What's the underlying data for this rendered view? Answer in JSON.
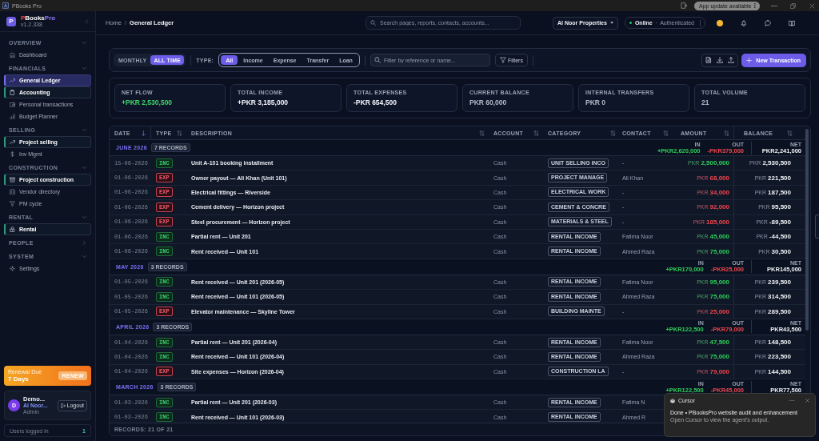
{
  "titlebar": {
    "app_name": "PBooks Pro",
    "update_notice": "App update available"
  },
  "sidebar": {
    "logo_letter": "P",
    "brand": [
      {
        "text": "P",
        "color": "#ef4444"
      },
      {
        "text": "Books",
        "color": "#ffffff"
      },
      {
        "text": "Pro",
        "color": "#8b7cf6"
      }
    ],
    "version": "v1.2.338",
    "sections": [
      {
        "title": "OVERVIEW",
        "expanded": true,
        "items": [
          {
            "label": "Dashboard",
            "selected": false,
            "highlighted": false
          }
        ]
      },
      {
        "title": "FINANCIALS",
        "expanded": true,
        "items": [
          {
            "label": "General Ledger",
            "selected": true,
            "highlighted": false
          },
          {
            "label": "Accounting",
            "selected": false,
            "highlighted": true
          },
          {
            "label": "Personal transactions",
            "selected": false,
            "highlighted": false
          },
          {
            "label": "Budget Planner",
            "selected": false,
            "highlighted": false
          }
        ]
      },
      {
        "title": "SELLING",
        "expanded": true,
        "items": [
          {
            "label": "Project selling",
            "selected": false,
            "highlighted": true
          },
          {
            "label": "Inv Mgmt",
            "selected": false,
            "highlighted": false
          }
        ]
      },
      {
        "title": "CONSTRUCTION",
        "expanded": true,
        "items": [
          {
            "label": "Project construction",
            "selected": false,
            "highlighted": true
          },
          {
            "label": "Vendor directory",
            "selected": false,
            "highlighted": false
          },
          {
            "label": "PM cycle",
            "selected": false,
            "highlighted": false
          }
        ]
      },
      {
        "title": "RENTAL",
        "expanded": true,
        "items": [
          {
            "label": "Rental",
            "selected": false,
            "highlighted": true
          }
        ]
      },
      {
        "title": "PEOPLE",
        "expanded": false
      },
      {
        "title": "SYSTEM",
        "expanded": true,
        "items": [
          {
            "label": "Settings",
            "selected": false,
            "highlighted": false
          }
        ]
      }
    ],
    "renewal": {
      "title": "Renewal Due",
      "days": "7 Days",
      "button": "RENEW"
    },
    "user": {
      "avatar_letter": "D",
      "name": "Demo...",
      "organization": "Al Noor...",
      "role": "Admin",
      "logout": "Logout"
    },
    "sessions": {
      "label": "Users logged in",
      "count": "1"
    }
  },
  "topbar": {
    "breadcrumbs": [
      "Home",
      "General Ledger"
    ],
    "breadcrumb_separator": "/",
    "search_placeholder": "Search pages, reports, contacts, accounts...",
    "company": "Al Noor Properties",
    "status": {
      "online": true,
      "label": "Online",
      "detail": "Authenticated"
    }
  },
  "toolbar": {
    "periods": [
      {
        "label": "MONTHLY",
        "selected": false
      },
      {
        "label": "ALL TIME",
        "selected": true
      }
    ],
    "type_label": "TYPE:",
    "types": [
      {
        "label": "All",
        "selected": true
      },
      {
        "label": "Income",
        "selected": false
      },
      {
        "label": "Expense",
        "selected": false
      },
      {
        "label": "Transfer",
        "selected": false
      },
      {
        "label": "Loan",
        "selected": false
      }
    ],
    "filter_placeholder": "Filter by reference or name...",
    "filters_button": "Filters",
    "new_button": "New Transaction"
  },
  "stats": [
    {
      "label": "NET FLOW",
      "value": "+PKR 2,530,500",
      "color": "#3fd46b"
    },
    {
      "label": "TOTAL INCOME",
      "value": "+PKR 3,185,000",
      "color": "#f1f3f8"
    },
    {
      "label": "TOTAL EXPENSES",
      "value": "-PKR 654,500",
      "color": "#f1f3f8"
    },
    {
      "label": "CURRENT BALANCE",
      "value": "PKR 60,000",
      "color": "#b3bac8"
    },
    {
      "label": "INTERNAL TRANSFERS",
      "value": "PKR 0",
      "color": "#b3bac8"
    },
    {
      "label": "TOTAL VOLUME",
      "value": "21",
      "color": "#b3bac8"
    }
  ],
  "table": {
    "columns": [
      {
        "label": "DATE",
        "sorted": true
      },
      {
        "label": "TYPE",
        "sorted": false
      },
      {
        "label": "DESCRIPTION",
        "sorted": false
      },
      {
        "label": "ACCOUNT",
        "sorted": false
      },
      {
        "label": "CATEGORY",
        "sorted": false
      },
      {
        "label": "CONTACT",
        "sorted": false
      },
      {
        "label": "AMOUNT",
        "sorted": false
      },
      {
        "label": "BALANCE",
        "sorted": false
      }
    ],
    "groups": [
      {
        "month": "JUNE 2026",
        "count": "7 RECORDS",
        "in_label": "IN",
        "in": "+PKR2,620,000",
        "out_label": "OUT",
        "out": "-PKR379,000",
        "net_label": "NET",
        "net": "PKR2,241,000",
        "rows": [
          {
            "date": "15-06-2026",
            "type": "INC",
            "kind": "income",
            "description": "Unit A-101 booking installment",
            "account": "Cash",
            "category": "UNIT SELLING INCO",
            "contact": "-",
            "amount_currency": "PKR",
            "amount": "2,500,000",
            "balance_currency": "PKR",
            "balance": "2,530,500"
          },
          {
            "date": "01-06-2026",
            "type": "EXP",
            "kind": "expense",
            "description": "Owner payout — Ali Khan (Unit 101)",
            "account": "Cash",
            "category": "PROJECT MANAGE",
            "contact": "Ali Khan",
            "amount_currency": "PKR",
            "amount": "68,000",
            "balance_currency": "PKR",
            "balance": "221,500"
          },
          {
            "date": "01-06-2026",
            "type": "EXP",
            "kind": "expense",
            "description": "Electrical fittings — Riverside",
            "account": "Cash",
            "category": "ELECTRICAL WORK",
            "contact": "-",
            "amount_currency": "PKR",
            "amount": "34,000",
            "balance_currency": "PKR",
            "balance": "187,500"
          },
          {
            "date": "01-06-2026",
            "type": "EXP",
            "kind": "expense",
            "description": "Cement delivery — Horizon project",
            "account": "Cash",
            "category": "CEMENT & CONCRE",
            "contact": "-",
            "amount_currency": "PKR",
            "amount": "92,000",
            "balance_currency": "PKR",
            "balance": "95,500"
          },
          {
            "date": "01-06-2026",
            "type": "EXP",
            "kind": "expense",
            "description": "Steel procurement — Horizon project",
            "account": "Cash",
            "category": "MATERIALS & STEEL",
            "contact": "-",
            "amount_currency": "PKR",
            "amount": "185,000",
            "balance_currency": "PKR",
            "balance": "-89,500"
          },
          {
            "date": "01-06-2026",
            "type": "INC",
            "kind": "income",
            "description": "Partial rent — Unit 201",
            "account": "Cash",
            "category": "RENTAL INCOME",
            "contact": "Fatima Noor",
            "amount_currency": "PKR",
            "amount": "45,000",
            "balance_currency": "PKR",
            "balance": "-44,500"
          },
          {
            "date": "01-06-2026",
            "type": "INC",
            "kind": "income",
            "description": "Rent received — Unit 101",
            "account": "Cash",
            "category": "RENTAL INCOME",
            "contact": "Ahmed Raza",
            "amount_currency": "PKR",
            "amount": "75,000",
            "balance_currency": "PKR",
            "balance": "30,500"
          }
        ]
      },
      {
        "month": "MAY 2026",
        "count": "3 RECORDS",
        "in_label": "IN",
        "in": "+PKR170,000",
        "out_label": "OUT",
        "out": "-PKR25,000",
        "net_label": "NET",
        "net": "PKR145,000",
        "rows": [
          {
            "date": "01-05-2026",
            "type": "INC",
            "kind": "income",
            "description": "Rent received — Unit 201 (2026-05)",
            "account": "Cash",
            "category": "RENTAL INCOME",
            "contact": "Fatima Noor",
            "amount_currency": "PKR",
            "amount": "95,000",
            "balance_currency": "PKR",
            "balance": "239,500"
          },
          {
            "date": "01-05-2026",
            "type": "INC",
            "kind": "income",
            "description": "Rent received — Unit 101 (2026-05)",
            "account": "Cash",
            "category": "RENTAL INCOME",
            "contact": "Ahmed Raza",
            "amount_currency": "PKR",
            "amount": "75,000",
            "balance_currency": "PKR",
            "balance": "314,500"
          },
          {
            "date": "01-05-2026",
            "type": "EXP",
            "kind": "expense",
            "description": "Elevator maintenance — Skyline Tower",
            "account": "Cash",
            "category": "BUILDING MAINTE",
            "contact": "-",
            "amount_currency": "PKR",
            "amount": "25,000",
            "balance_currency": "PKR",
            "balance": "289,500"
          }
        ]
      },
      {
        "month": "APRIL 2026",
        "count": "3 RECORDS",
        "in_label": "IN",
        "in": "+PKR122,500",
        "out_label": "OUT",
        "out": "-PKR79,000",
        "net_label": "NET",
        "net": "PKR43,500",
        "rows": [
          {
            "date": "01-04-2026",
            "type": "INC",
            "kind": "income",
            "description": "Partial rent — Unit 201 (2026-04)",
            "account": "Cash",
            "category": "RENTAL INCOME",
            "contact": "Fatima Noor",
            "amount_currency": "PKR",
            "amount": "47,500",
            "balance_currency": "PKR",
            "balance": "148,500"
          },
          {
            "date": "01-04-2026",
            "type": "INC",
            "kind": "income",
            "description": "Rent received — Unit 101 (2026-04)",
            "account": "Cash",
            "category": "RENTAL INCOME",
            "contact": "Ahmed Raza",
            "amount_currency": "PKR",
            "amount": "75,000",
            "balance_currency": "PKR",
            "balance": "223,500"
          },
          {
            "date": "01-04-2026",
            "type": "EXP",
            "kind": "expense",
            "description": "Site expenses — Horizon (2026-04)",
            "account": "Cash",
            "category": "CONSTRUCTION LA",
            "contact": "-",
            "amount_currency": "PKR",
            "amount": "79,000",
            "balance_currency": "PKR",
            "balance": "144,500"
          }
        ]
      },
      {
        "month": "MARCH 2026",
        "count": "3 RECORDS",
        "in_label": "IN",
        "in": "+PKR122,500",
        "out_label": "OUT",
        "out": "-PKR45,000",
        "net_label": "NET",
        "net": "PKR77,500",
        "rows": [
          {
            "date": "01-03-2026",
            "type": "INC",
            "kind": "income",
            "description": "Partial rent — Unit 201 (2026-03)",
            "account": "Cash",
            "category": "RENTAL INCOME",
            "contact": "Fatima N"
          },
          {
            "date": "01-03-2026",
            "type": "INC",
            "kind": "income",
            "description": "Rent received — Unit 101 (2026-03)",
            "account": "Cash",
            "category": "RENTAL INCOME",
            "contact": "Ahmed R"
          }
        ]
      }
    ],
    "footer": "RECORDS: 21 OF 21"
  },
  "notification": {
    "app": "Cursor",
    "title": "Done • PBooksPro website audit and enhancement",
    "body": "Open Cursor to view the agent's output."
  }
}
